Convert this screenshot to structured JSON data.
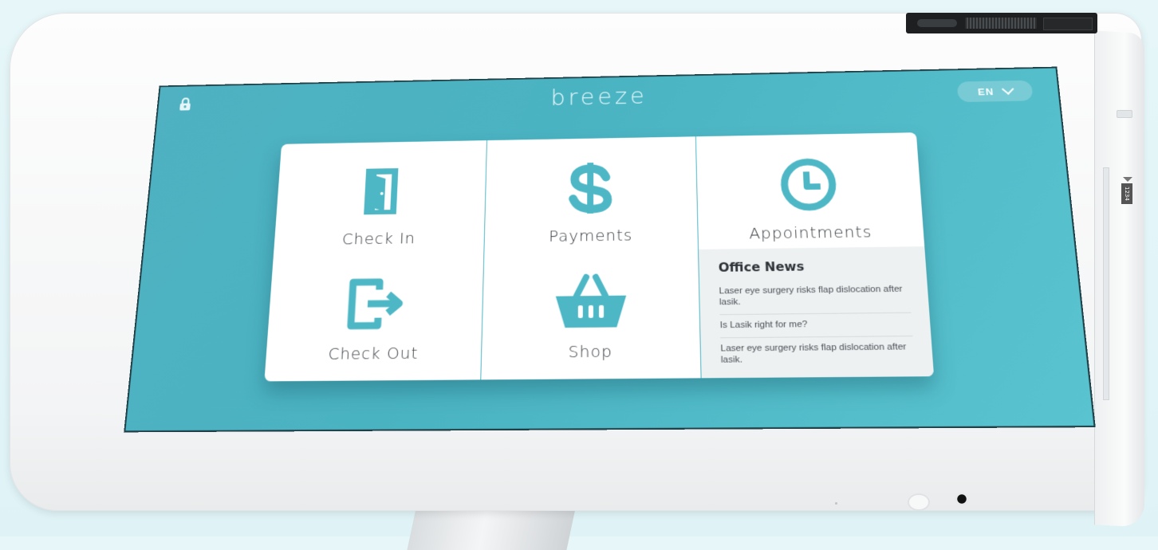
{
  "header": {
    "brand": "breeze",
    "language": "EN"
  },
  "tiles": [
    {
      "label": "Check In",
      "icon": "door-icon"
    },
    {
      "label": "Payments",
      "icon": "dollar-icon"
    },
    {
      "label": "Appointments",
      "icon": "clock-icon"
    },
    {
      "label": "Check Out",
      "icon": "exit-icon"
    },
    {
      "label": "Shop",
      "icon": "basket-icon"
    }
  ],
  "news": {
    "title": "Office News",
    "items": [
      "Laser eye surgery risks flap dislocation after lasik.",
      "Is Lasik right for me?",
      "Laser eye surgery risks flap dislocation after lasik."
    ]
  },
  "device": {
    "card_reader_label": "1234"
  },
  "colors": {
    "accent": "#4db7c6",
    "screen_bg": "#4fb1c1",
    "text": "#3a3f44"
  }
}
